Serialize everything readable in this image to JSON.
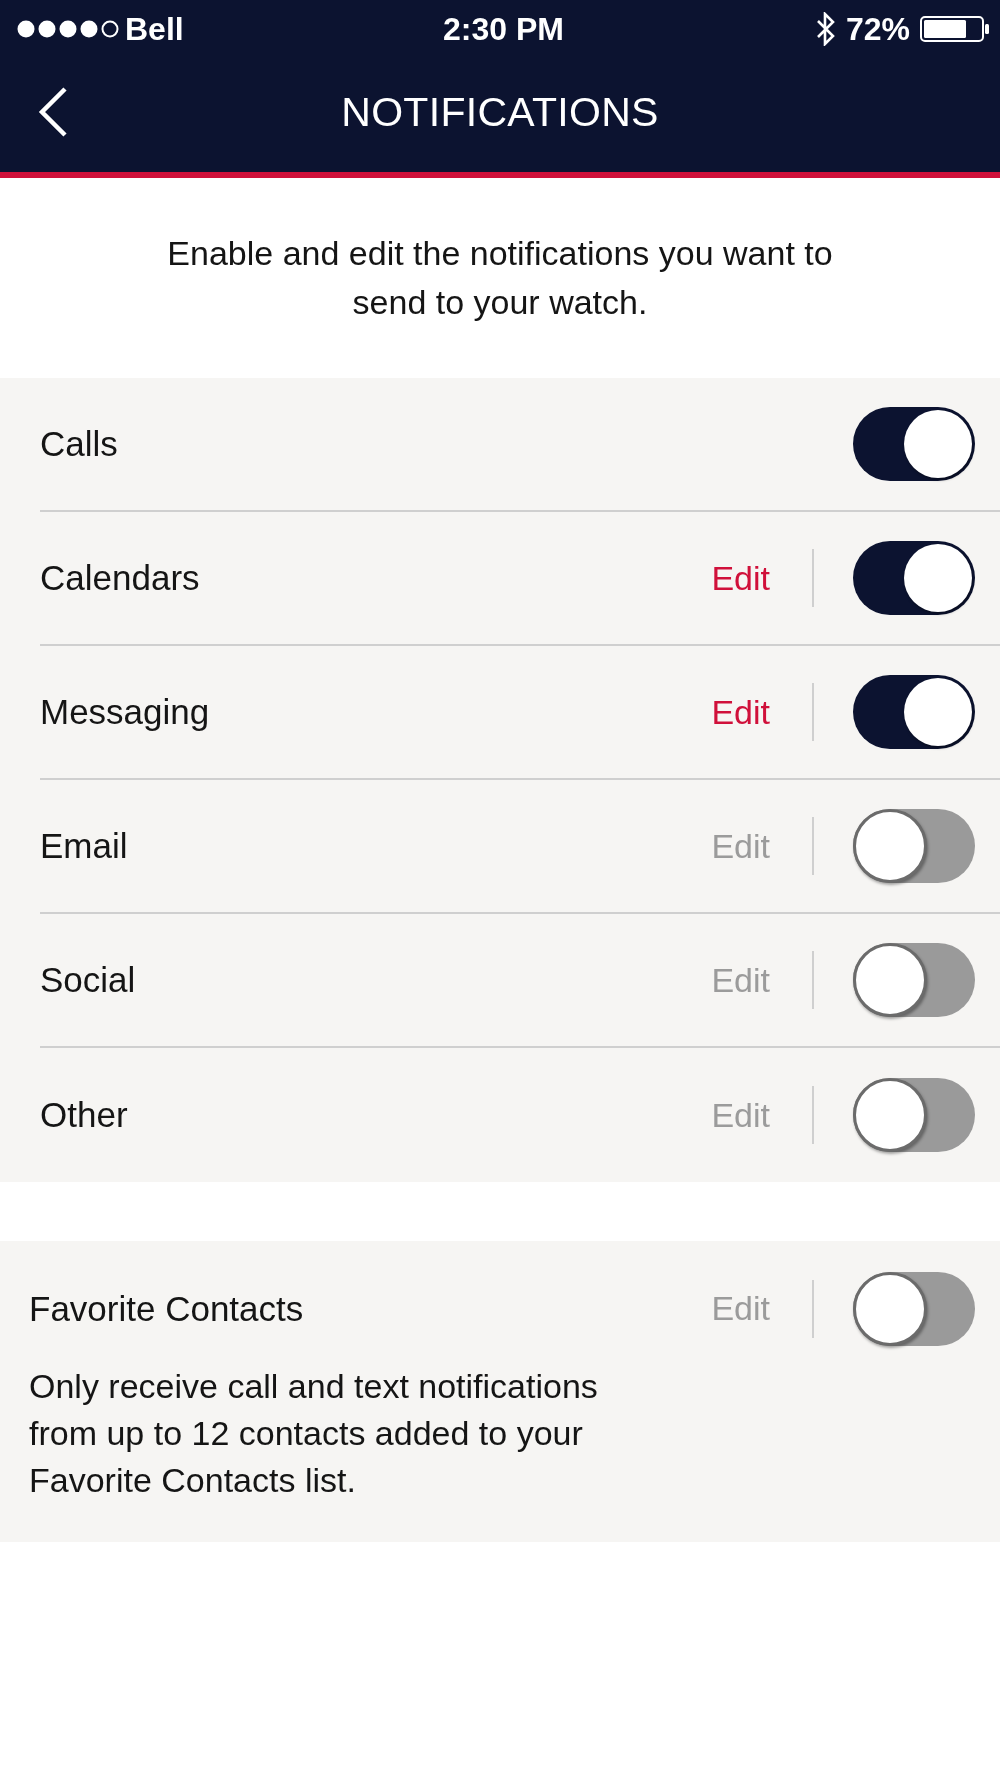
{
  "status_bar": {
    "carrier": "Bell",
    "time": "2:30 PM",
    "battery": "72%"
  },
  "header": {
    "title": "NOTIFICATIONS"
  },
  "intro": "Enable and edit the notifications you want to send to your watch.",
  "rows": [
    {
      "label": "Calls",
      "on": true
    },
    {
      "label": "Calendars",
      "edit": "Edit",
      "on": true
    },
    {
      "label": "Messaging",
      "edit": "Edit",
      "on": true
    },
    {
      "label": "Email",
      "edit": "Edit",
      "on": false
    },
    {
      "label": "Social",
      "edit": "Edit",
      "on": false
    },
    {
      "label": "Other",
      "edit": "Edit",
      "on": false
    }
  ],
  "favorites": {
    "label": "Favorite Contacts",
    "edit": "Edit",
    "on": false,
    "description": "Only receive call and text notifications from up to 12 contacts added to your Favorite Contacts list."
  }
}
